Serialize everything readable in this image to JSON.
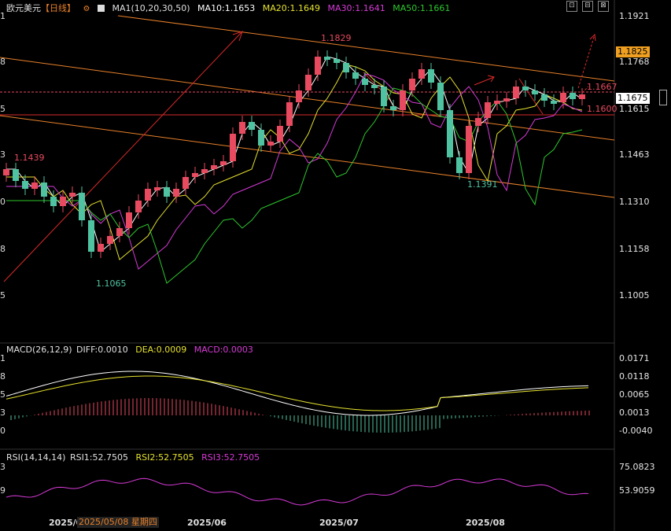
{
  "header": {
    "symbol": "欧元美元",
    "period": "【日线】",
    "ma_label": "MA1(10,20,30,50)",
    "ma10": "MA10:1.1653",
    "ma20": "MA20:1.1649",
    "ma30": "MA30:1.1641",
    "ma50": "MA50:1.1661"
  },
  "toolbar": {
    "btn1": "⊡",
    "btn2": "⊟",
    "btn3": "⊠"
  },
  "price_axis": [
    "1.1921",
    "1.1825",
    "1.1768",
    "1.1675",
    "1.1615",
    "1.1463",
    "1.1310",
    "1.1158",
    "1.1005"
  ],
  "left_edge_labels": [
    "1",
    "8",
    "5",
    "3",
    "0",
    "8",
    "5"
  ],
  "annotations": {
    "high": "1.1829",
    "left_high": "1.1439",
    "low1": "1.1065",
    "low2": "1.1391",
    "level_1667": "1.1667",
    "level_1600": "1.1600",
    "current": "1.1675"
  },
  "macd": {
    "title": "MACD(26,12,9)",
    "diff": "DIFF:0.0010",
    "dea": "DEA:0.0009",
    "macd": "MACD:0.0003",
    "axis": [
      "0.0171",
      "0.0118",
      "0.0065",
      "0.0013",
      "-0.0040"
    ],
    "left_edge": [
      "1",
      "8",
      "5",
      "3",
      "0"
    ]
  },
  "rsi": {
    "title": "RSI(14,14,14)",
    "rsi1": "RSI1:52.7505",
    "rsi2": "RSI2:52.7505",
    "rsi3": "RSI3:52.7505",
    "axis": [
      "75.0823",
      "53.9059"
    ],
    "left_edge": [
      "3",
      "9"
    ]
  },
  "time_axis": {
    "t0": "2025/0",
    "cursor": "2025/05/08 星期四",
    "t1": "2025/06",
    "t2": "2025/07",
    "t3": "2025/08"
  },
  "colors": {
    "up": "#e84a5f",
    "down": "#4fc3a1",
    "ma10": "#ffffff",
    "ma20": "#e6e22e",
    "ma30": "#d63ad6",
    "ma50": "#2ec82e",
    "channel": "#e8802a",
    "trend": "#d92a2a"
  }
}
